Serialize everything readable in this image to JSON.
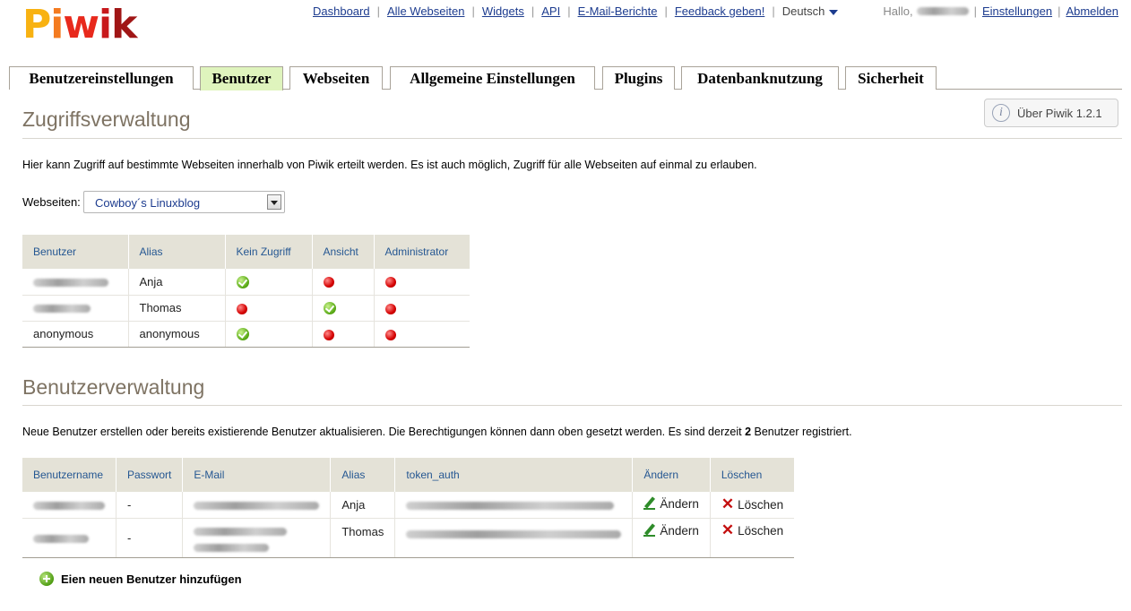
{
  "logo": {
    "letters": [
      "P",
      "i",
      "w",
      "i",
      "k"
    ],
    "colors": [
      "#f8b212",
      "#f47b20",
      "#e8291c",
      "#c8191c",
      "#a01616"
    ]
  },
  "topnav": {
    "links": [
      "Dashboard",
      "Alle Webseiten",
      "Widgets",
      "API",
      "E-Mail-Berichte",
      "Feedback geben!"
    ],
    "language": "Deutsch"
  },
  "usernav": {
    "hello": "Hallo,",
    "settings": "Einstellungen",
    "logout": "Abmelden"
  },
  "tabs": [
    "Benutzereinstellungen",
    "Benutzer",
    "Webseiten",
    "Allgemeine Einstellungen",
    "Plugins",
    "Datenbanknutzung",
    "Sicherheit"
  ],
  "active_tab": "Benutzer",
  "about_button": "Über Piwik 1.2.1",
  "access": {
    "title": "Zugriffsverwaltung",
    "intro": "Hier kann Zugriff auf bestimmte Webseiten innerhalb von Piwik erteilt werden. Es ist auch möglich, Zugriff für alle Webseiten auf einmal zu erlauben.",
    "site_label": "Webseiten:",
    "site_value": "Cowboy´s Linuxblog",
    "columns": [
      "Benutzer",
      "Alias",
      "Kein Zugriff",
      "Ansicht",
      "Administrator"
    ],
    "rows": [
      {
        "user": "",
        "alias": "Anja",
        "access": "noaccess"
      },
      {
        "user": "",
        "alias": "Thomas",
        "access": "view"
      },
      {
        "user": "anonymous",
        "alias": "anonymous",
        "access": "noaccess"
      }
    ]
  },
  "users": {
    "title": "Benutzerverwaltung",
    "intro_before": "Neue Benutzer erstellen oder bereits existierende Benutzer aktualisieren. Die Berechtigungen können dann oben gesetzt werden. Es sind derzeit ",
    "count": "2",
    "intro_after": " Benutzer registriert.",
    "columns": [
      "Benutzername",
      "Passwort",
      "E-Mail",
      "Alias",
      "token_auth",
      "Ändern",
      "Löschen"
    ],
    "rows": [
      {
        "password": "-",
        "alias": "Anja",
        "edit": "Ändern",
        "delete": "Löschen"
      },
      {
        "password": "-",
        "alias": "Thomas",
        "edit": "Ändern",
        "delete": "Löschen"
      }
    ],
    "add_user": "Eien neuen Benutzer hinzufügen"
  }
}
